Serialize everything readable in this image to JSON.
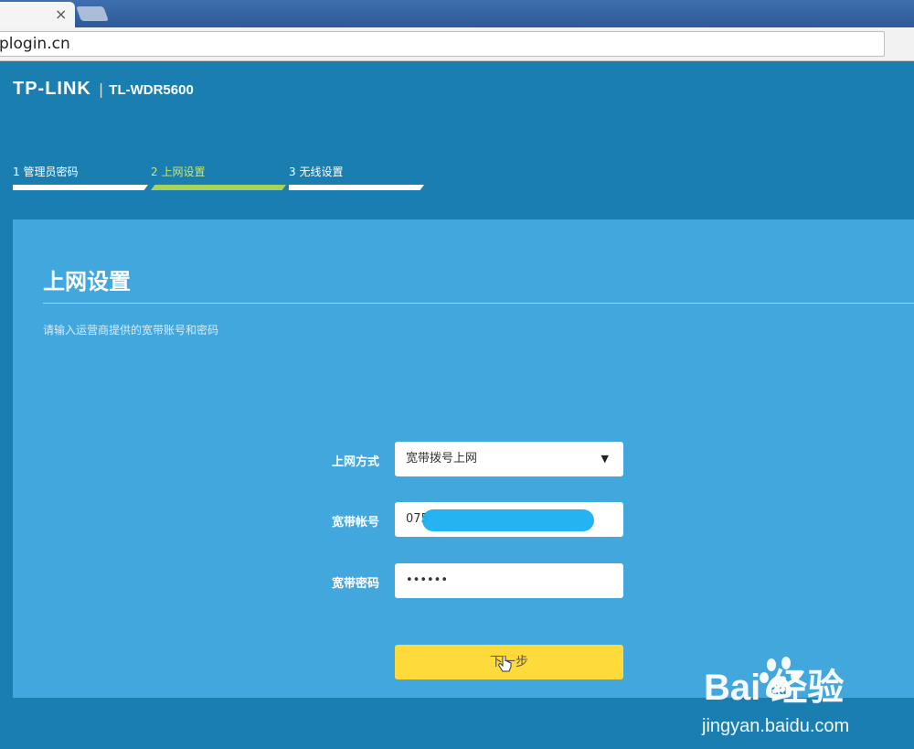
{
  "browser": {
    "address": "plogin.cn",
    "tab_close": "×"
  },
  "header": {
    "logo": "TP-LINK",
    "separator": "|",
    "model": "TL-WDR5600"
  },
  "steps": [
    {
      "label": "1 管理员密码",
      "active": false
    },
    {
      "label": "2 上网设置",
      "active": true
    },
    {
      "label": "3 无线设置",
      "active": false
    }
  ],
  "panel": {
    "title": "上网设置",
    "hint": "请输入运营商提供的宽带账号和密码"
  },
  "form": {
    "mode_label": "上网方式",
    "mode_value": "宽带拨号上网",
    "account_label": "宽带帐号",
    "account_value": "075",
    "password_label": "宽带密码",
    "password_value": "••••••",
    "next_label": "下一步"
  },
  "watermark": {
    "logo": "Bai  经验",
    "url": "jingyan.baidu.com"
  },
  "colors": {
    "page_bg": "#1a7fb0",
    "panel_bg": "#42a7dc",
    "active_step": "#a8d35a",
    "next_button": "#fedb3b"
  }
}
